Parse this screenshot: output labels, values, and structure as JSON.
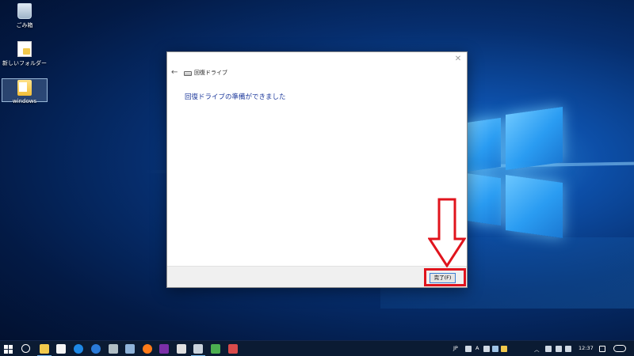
{
  "desktop": {
    "icons": [
      {
        "label": "ごみ箱"
      },
      {
        "label": "新しいフォルダー"
      },
      {
        "label": "windows"
      }
    ]
  },
  "dialog": {
    "close_symbol": "✕",
    "back_symbol": "←",
    "title": "回復ドライブ",
    "heading": "回復ドライブの準備ができました",
    "finish_label": "完了(F)"
  },
  "taskbar": {
    "ime_label": "JP",
    "ime_mode": "A",
    "clock": "12:37"
  },
  "colors": {
    "heading": "#1e3a9c",
    "highlight": "#e0141d",
    "taskbar": "#0b1b33"
  }
}
